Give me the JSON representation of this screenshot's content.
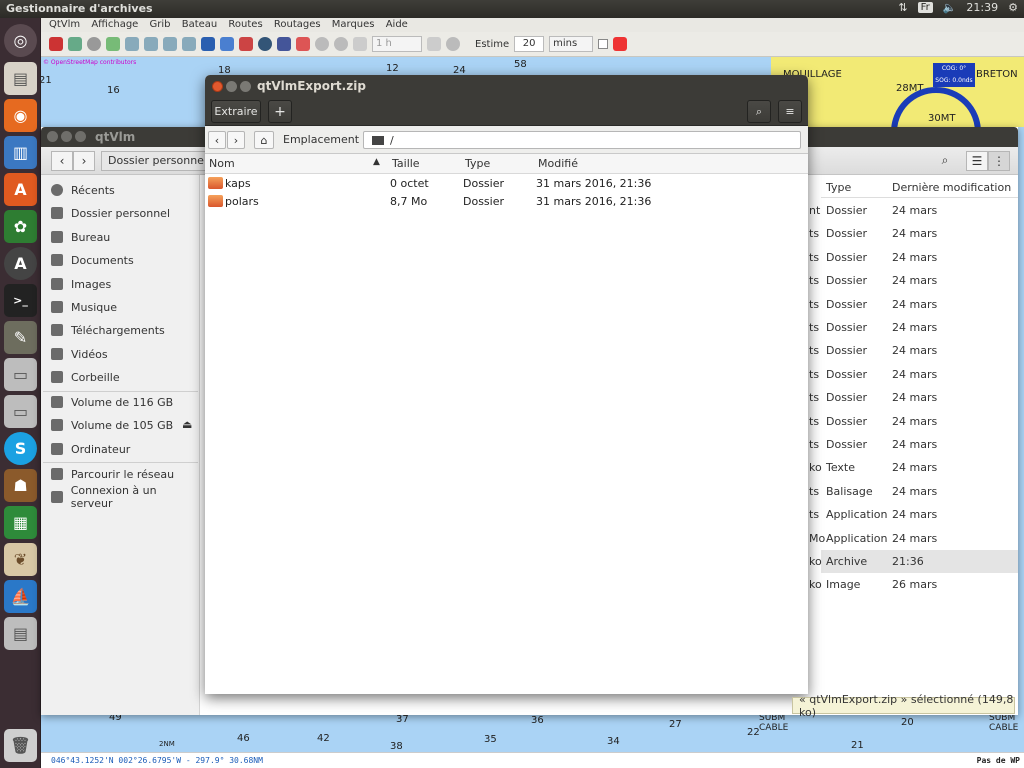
{
  "panel": {
    "app_title": "Gestionnaire d'archives",
    "kbd": "Fr",
    "time": "21:39"
  },
  "qtvlm": {
    "menu": [
      "QtVlm",
      "Affichage",
      "Grib",
      "Bateau",
      "Routes",
      "Routages",
      "Marques",
      "Aide"
    ],
    "toolbar": {
      "step_value": "1 h",
      "estime_label": "Estime",
      "estime_value": "20",
      "unit": "mins"
    },
    "chart": {
      "osm_credit": "© OpenStreetMap contributors",
      "place": "BRETON",
      "marker": "28MT",
      "marker2": "30MT",
      "boat_label": "MOUILLAGE",
      "cog": "COG: 0°",
      "sog": "SOG: 0.0nds",
      "depths": [
        "21",
        "16",
        "18",
        "12",
        "24",
        "58",
        "49",
        "37",
        "36",
        "27",
        "20",
        "21",
        "46",
        "42",
        "38",
        "35",
        "34",
        "22",
        "2NM"
      ],
      "cable": "SUBM CABLE"
    },
    "status": {
      "coords": "046°43.1252'N  002°26.6795'W - 297.9°   30.68NM",
      "right": "Pas de WP"
    }
  },
  "nautilus": {
    "title": "qtVlm",
    "breadcrumb": "Dossier personnel",
    "sidebar": [
      {
        "label": "Récents",
        "icon": "clock-icon"
      },
      {
        "label": "Dossier personnel",
        "icon": "home-icon"
      },
      {
        "label": "Bureau",
        "icon": "folder-icon"
      },
      {
        "label": "Documents",
        "icon": "document-icon"
      },
      {
        "label": "Images",
        "icon": "camera-icon"
      },
      {
        "label": "Musique",
        "icon": "music-icon"
      },
      {
        "label": "Téléchargements",
        "icon": "download-icon"
      },
      {
        "label": "Vidéos",
        "icon": "video-icon"
      },
      {
        "label": "Corbeille",
        "icon": "trash-icon"
      },
      {
        "label": "Volume de 116 GB",
        "icon": "drive-icon"
      },
      {
        "label": "Volume de 105 GB",
        "icon": "drive-icon"
      },
      {
        "label": "Ordinateur",
        "icon": "computer-icon"
      },
      {
        "label": "Parcourir le réseau",
        "icon": "network-icon"
      },
      {
        "label": "Connexion à un serveur",
        "icon": "server-icon"
      }
    ],
    "columns": {
      "type": "Type",
      "modified": "Dernière modification"
    },
    "rows": [
      {
        "left": "nt",
        "type": "Dossier",
        "date": "24 mars"
      },
      {
        "left": "ts",
        "type": "Dossier",
        "date": "24 mars"
      },
      {
        "left": "ts",
        "type": "Dossier",
        "date": "24 mars"
      },
      {
        "left": "ts",
        "type": "Dossier",
        "date": "24 mars"
      },
      {
        "left": "ts",
        "type": "Dossier",
        "date": "24 mars"
      },
      {
        "left": "ts",
        "type": "Dossier",
        "date": "24 mars"
      },
      {
        "left": "ts",
        "type": "Dossier",
        "date": "24 mars"
      },
      {
        "left": "ts",
        "type": "Dossier",
        "date": "24 mars"
      },
      {
        "left": "ts",
        "type": "Dossier",
        "date": "24 mars"
      },
      {
        "left": "ts",
        "type": "Dossier",
        "date": "24 mars"
      },
      {
        "left": "ts",
        "type": "Dossier",
        "date": "24 mars"
      },
      {
        "left": "ko",
        "type": "Texte",
        "date": "24 mars"
      },
      {
        "left": "ts",
        "type": "Balisage",
        "date": "24 mars"
      },
      {
        "left": "ts",
        "type": "Application",
        "date": "24 mars"
      },
      {
        "left": "Mo",
        "type": "Application",
        "date": "24 mars"
      },
      {
        "left": "ko",
        "type": "Archive",
        "date": "21:36"
      },
      {
        "left": "ko",
        "type": "Image",
        "date": "26 mars"
      }
    ],
    "status": "« qtVlmExport.zip » sélectionné  (149,8 ko)"
  },
  "archive": {
    "title": "qtVlmExport.zip",
    "extract_label": "Extraire",
    "add_label": "+",
    "location_label": "Emplacement :",
    "location_value": "/",
    "columns": {
      "name": "Nom",
      "size": "Taille",
      "type": "Type",
      "modified": "Modifié"
    },
    "files": [
      {
        "name": "kaps",
        "size": "0 octet",
        "type": "Dossier",
        "modified": "31 mars 2016, 21:36"
      },
      {
        "name": "polars",
        "size": "8,7 Mo",
        "type": "Dossier",
        "modified": "31 mars 2016, 21:36"
      }
    ]
  }
}
